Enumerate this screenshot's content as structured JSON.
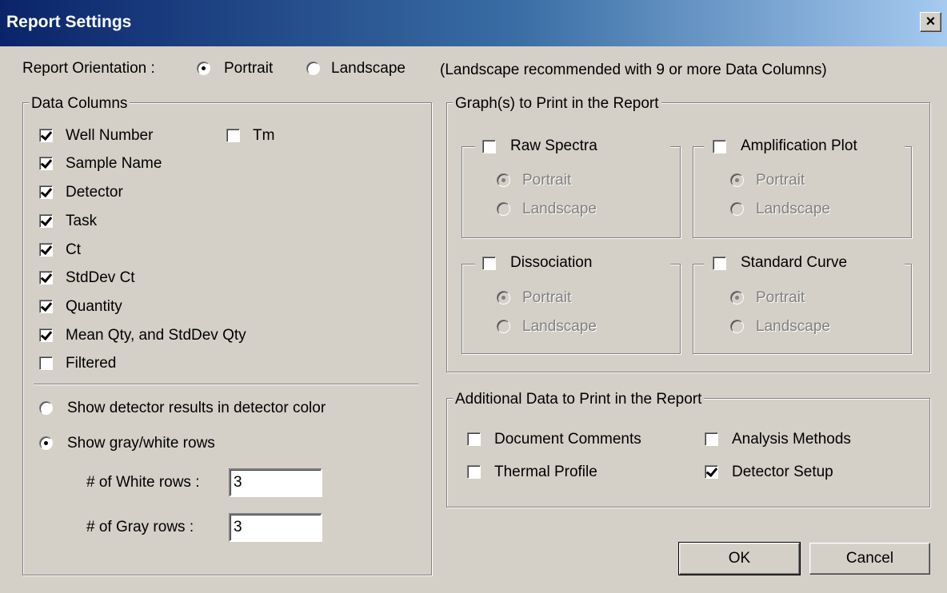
{
  "window": {
    "title": "Report Settings",
    "close_label": "×"
  },
  "orientation": {
    "label": "Report Orientation :",
    "portrait": "Portrait",
    "landscape": "Landscape",
    "selected": "Portrait",
    "hint": "(Landscape recommended with 9 or more Data Columns)"
  },
  "data_columns": {
    "title": "Data Columns",
    "items": [
      {
        "label": "Well Number",
        "checked": true
      },
      {
        "label": "Sample Name",
        "checked": true
      },
      {
        "label": "Detector",
        "checked": true
      },
      {
        "label": "Task",
        "checked": true
      },
      {
        "label": "Ct",
        "checked": true
      },
      {
        "label": "StdDev Ct",
        "checked": true
      },
      {
        "label": "Quantity",
        "checked": true
      },
      {
        "label": "Mean Qty, and StdDev Qty",
        "checked": true
      },
      {
        "label": "Filtered",
        "checked": false
      }
    ],
    "tm": {
      "label": "Tm",
      "checked": false
    }
  },
  "display": {
    "detector_color": "Show detector results in detector color",
    "gray_white": "Show gray/white rows",
    "selected": "gray_white",
    "white_rows_label": "# of White rows :",
    "white_rows_value": "3",
    "gray_rows_label": "# of Gray rows :",
    "gray_rows_value": "3"
  },
  "graphs": {
    "title": "Graph(s) to Print in the Report",
    "items": [
      {
        "label": "Raw Spectra",
        "portrait": "Portrait",
        "landscape": "Landscape"
      },
      {
        "label": "Amplification Plot",
        "portrait": "Portrait",
        "landscape": "Landscape"
      },
      {
        "label": "Dissociation",
        "portrait": "Portrait",
        "landscape": "Landscape"
      },
      {
        "label": "Standard Curve",
        "portrait": "Portrait",
        "landscape": "Landscape"
      }
    ]
  },
  "additional": {
    "title": "Additional Data to Print in the Report",
    "document_comments": "Document Comments",
    "analysis_methods": "Analysis Methods",
    "thermal_profile": "Thermal Profile",
    "detector_setup": "Detector Setup"
  },
  "buttons": {
    "ok": "OK",
    "cancel": "Cancel"
  }
}
